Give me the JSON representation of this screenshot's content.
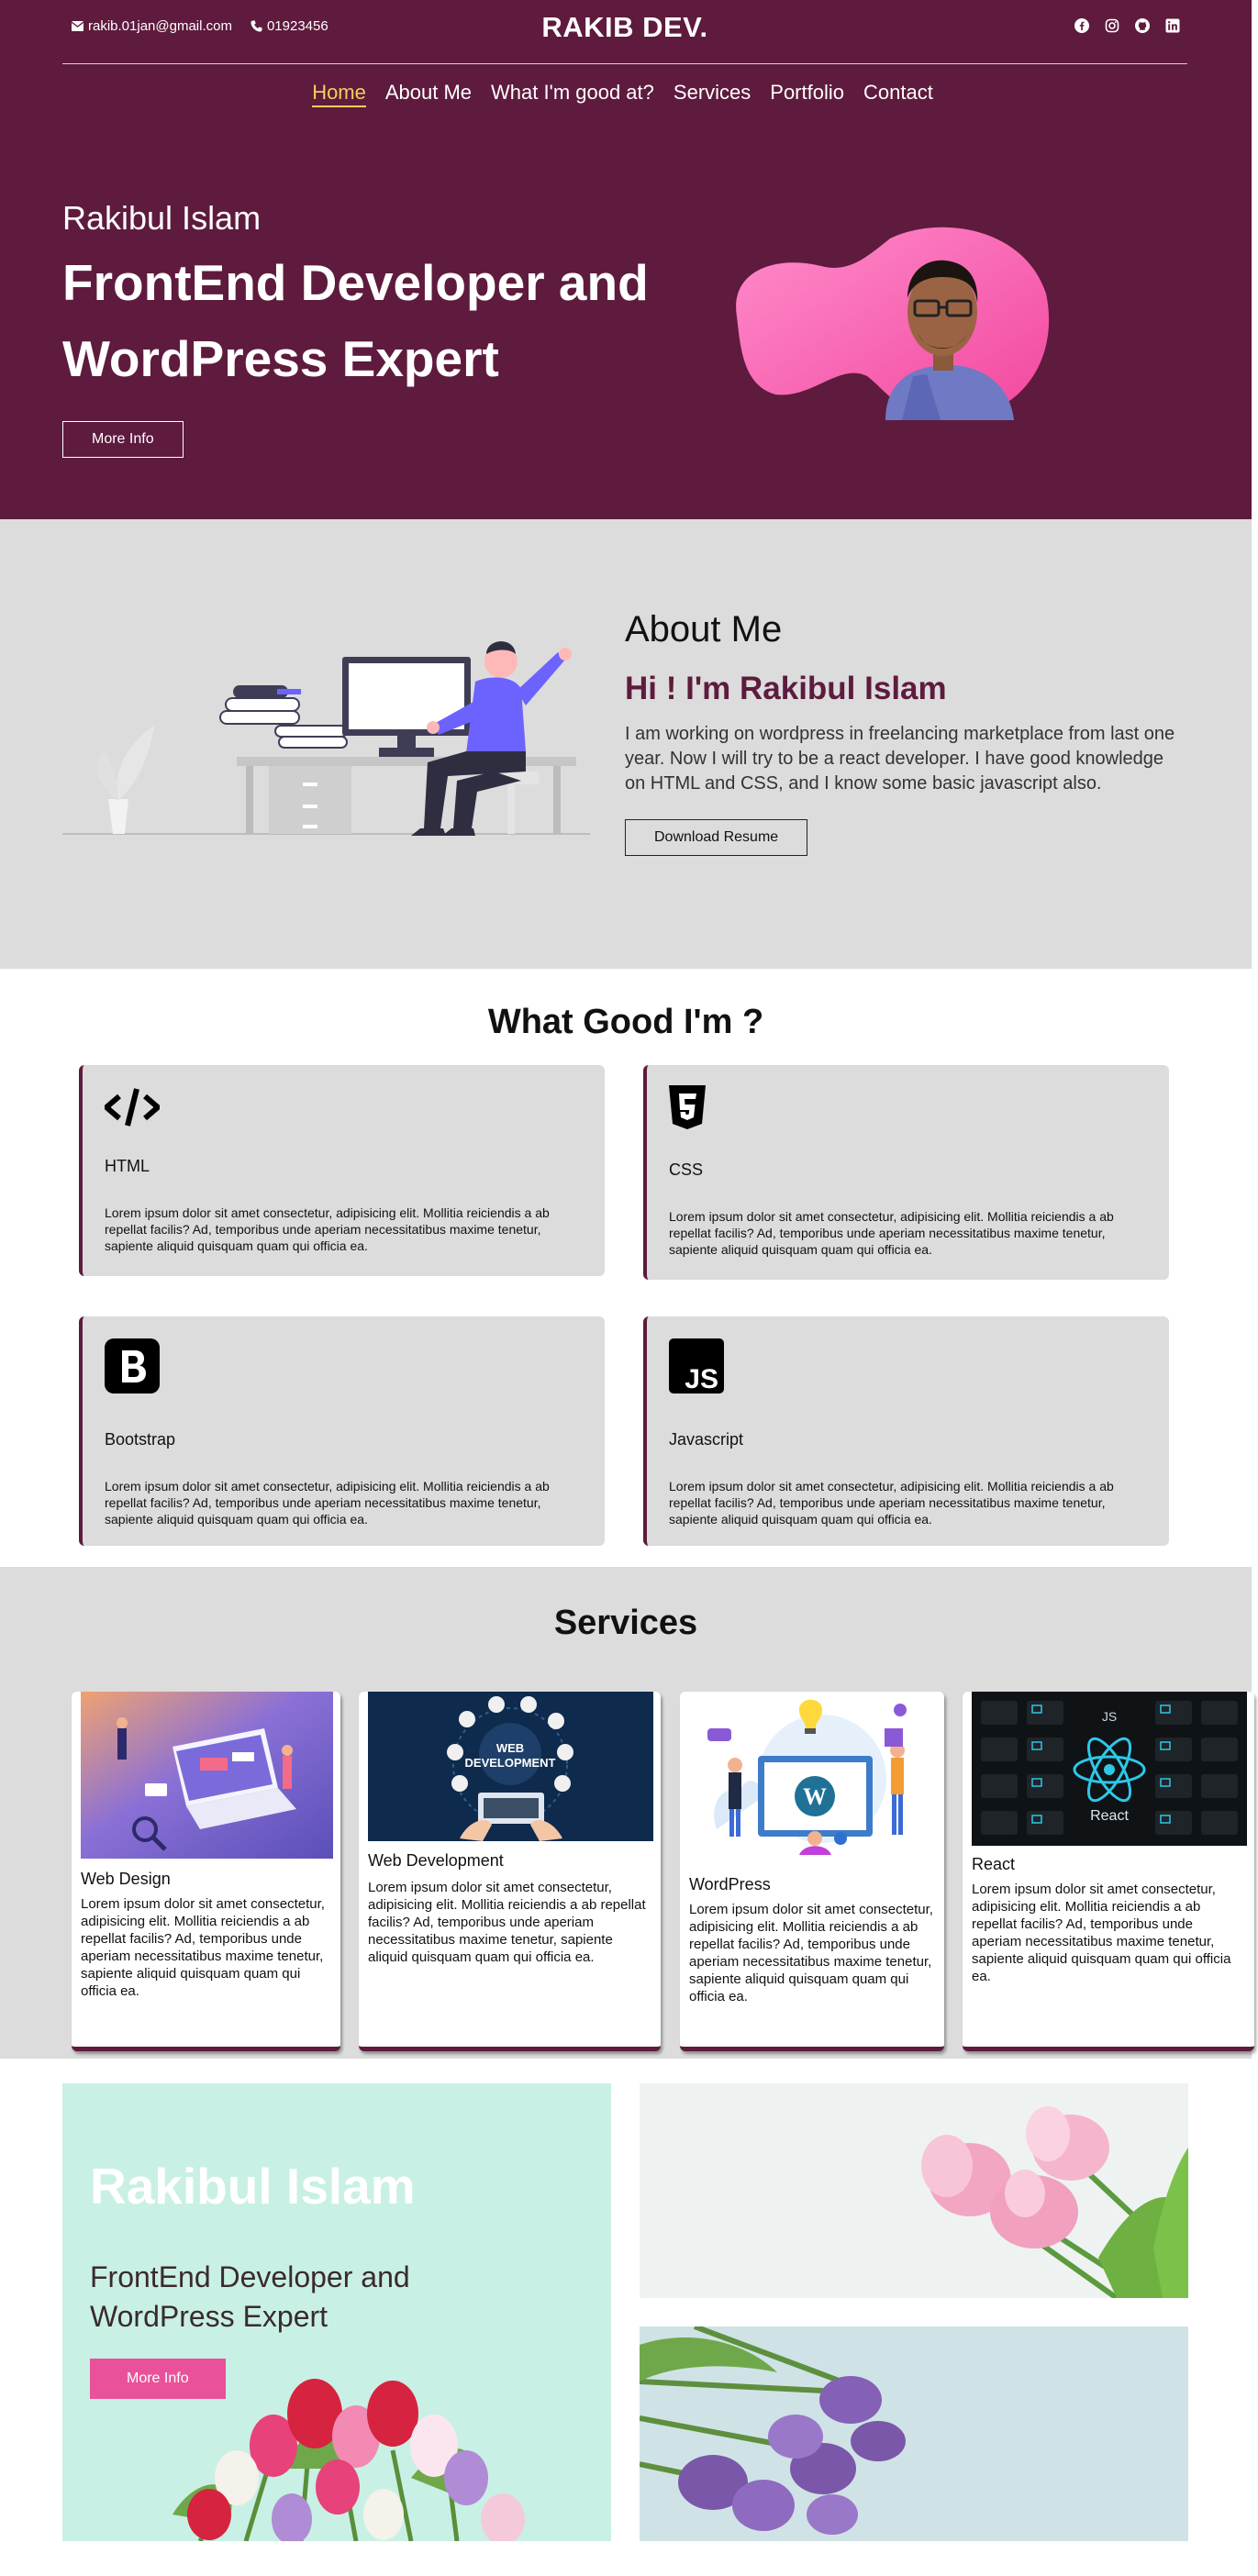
{
  "header": {
    "email": "rakib.01jan@gmail.com",
    "phone": "01923456",
    "brand": "RAKIB DEV.",
    "socials": [
      "facebook-icon",
      "instagram-icon",
      "github-icon",
      "linkedin-icon"
    ]
  },
  "nav": {
    "items": [
      {
        "label": "Home",
        "active": true
      },
      {
        "label": "About Me"
      },
      {
        "label": "What I'm good at?"
      },
      {
        "label": "Services"
      },
      {
        "label": "Portfolio"
      },
      {
        "label": "Contact"
      }
    ]
  },
  "hero": {
    "name": "Rakibul Islam",
    "title": "FrontEnd Developer and WordPress Expert",
    "button": "More Info"
  },
  "about": {
    "title": "About Me",
    "subtitle": "Hi ! I'm Rakibul Islam",
    "text": "I am working on wordpress in freelancing marketplace from last one year. Now I will try to be a react developer. I have good knowledge on HTML and CSS, and I know some basic javascript also.",
    "button": "Download Resume"
  },
  "skills": {
    "title": "What Good I'm ?",
    "items": [
      {
        "name": "HTML",
        "icon": "code-icon",
        "text": "Lorem ipsum dolor sit amet consectetur, adipisicing elit. Mollitia reiciendis a ab repellat facilis? Ad, temporibus unde aperiam necessitatibus maxime tenetur, sapiente aliquid quisquam quam qui officia ea."
      },
      {
        "name": "CSS",
        "icon": "css3-icon",
        "text": "Lorem ipsum dolor sit amet consectetur, adipisicing elit. Mollitia reiciendis a ab repellat facilis? Ad, temporibus unde aperiam necessitatibus maxime tenetur, sapiente aliquid quisquam quam qui officia ea."
      },
      {
        "name": "Bootstrap",
        "icon": "bootstrap-icon",
        "text": "Lorem ipsum dolor sit amet consectetur, adipisicing elit. Mollitia reiciendis a ab repellat facilis? Ad, temporibus unde aperiam necessitatibus maxime tenetur, sapiente aliquid quisquam quam qui officia ea."
      },
      {
        "name": "Javascript",
        "icon": "javascript-icon",
        "text": "Lorem ipsum dolor sit amet consectetur, adipisicing elit. Mollitia reiciendis a ab repellat facilis? Ad, temporibus unde aperiam necessitatibus maxime tenetur, sapiente aliquid quisquam quam qui officia ea."
      }
    ]
  },
  "services": {
    "title": "Services",
    "items": [
      {
        "name": "Web Design",
        "text": "Lorem ipsum dolor sit amet consectetur, adipisicing elit. Mollitia reiciendis a ab repellat facilis? Ad, temporibus unde aperiam necessitatibus maxime tenetur, sapiente aliquid quisquam quam qui officia ea."
      },
      {
        "name": "Web Development",
        "text": "Lorem ipsum dolor sit amet consectetur, adipisicing elit. Mollitia reiciendis a ab repellat facilis? Ad, temporibus unde aperiam necessitatibus maxime tenetur, sapiente aliquid quisquam quam qui officia ea.",
        "image_text": "WEB DEVELOPMENT"
      },
      {
        "name": "WordPress",
        "text": "Lorem ipsum dolor sit amet consectetur, adipisicing elit. Mollitia reiciendis a ab repellat facilis? Ad, temporibus unde aperiam necessitatibus maxime tenetur, sapiente aliquid quisquam quam qui officia ea."
      },
      {
        "name": "React",
        "text": "Lorem ipsum dolor sit amet consectetur, adipisicing elit. Mollitia reiciendis a ab repellat facilis? Ad, temporibus unde aperiam necessitatibus maxime tenetur, sapiente aliquid quisquam quam qui officia ea.",
        "image_text": "React",
        "image_badge": "JS"
      }
    ]
  },
  "gallery": {
    "name": "Rakibul Islam",
    "title": "FrontEnd Developer and WordPress Expert",
    "button": "More Info"
  },
  "colors": {
    "brand": "#5e1b3d",
    "accent": "#f1cf5c",
    "pink": "#e9529a",
    "section_gray": "#dcdcdc"
  }
}
